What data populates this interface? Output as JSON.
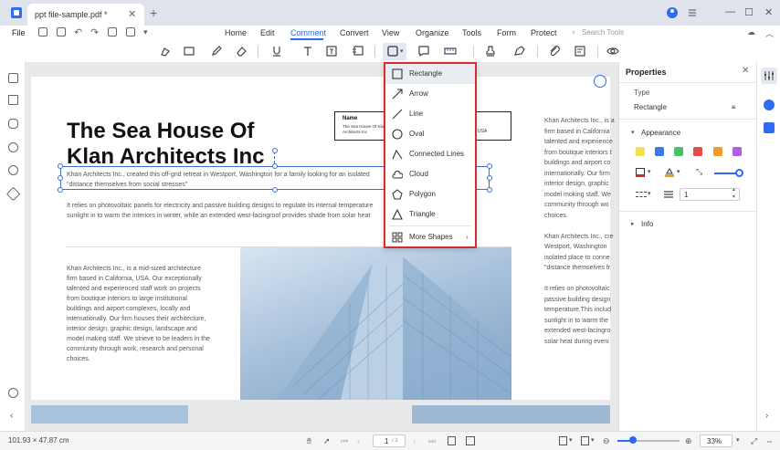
{
  "window": {
    "tab_title": "ppt file-sample.pdf *",
    "tab_close": "✕",
    "new_tab": "+",
    "minimize": "—",
    "maximize": "☐",
    "close": "✕"
  },
  "menubar": {
    "file": "File",
    "tabs": [
      {
        "label": "Home",
        "active": false
      },
      {
        "label": "Edit",
        "active": false
      },
      {
        "label": "Comment",
        "active": true
      },
      {
        "label": "Convert",
        "active": false
      },
      {
        "label": "View",
        "active": false
      },
      {
        "label": "Organize",
        "active": false
      },
      {
        "label": "Tools",
        "active": false
      },
      {
        "label": "Form",
        "active": false
      },
      {
        "label": "Protect",
        "active": false
      }
    ],
    "search_placeholder": "Search Tools"
  },
  "document": {
    "title_line1": "The Sea House Of",
    "title_line2": "Klan Architects Inc",
    "namebox": {
      "heading": "Name",
      "line1": "The Sea House Of Klan",
      "line2": "Architects Inc",
      "right": "USA"
    },
    "intro_line1": "Khan Architects Inc., created this off-grid retreat in Westport, Washington for a family looking for an isolated",
    "intro_line2": "\"distance themselves from social stresses\"",
    "para2_line1": "It relies on photovoltaic panels for electricity and passive building designs to regulate its internal temperature",
    "para2_line2": "sunlight in to warm the interiors in winter, while an extended west-facingroof provides shade from solar heat",
    "col1": [
      "Khan Architects Inc., is a mid-sized architecture",
      "firm based in California, USA. Our exceptionally",
      "talented and experienced staff work on projects",
      "from boutique interiors to large institutional",
      "buildings and airport complexes, locally and",
      "internationally. Our firm houses their architecture,",
      "interior design, graphic design, landscape and",
      "model making staff. We strieve to be leaders in the",
      "community through work, research and personal",
      "choices."
    ],
    "right_col": [
      "Khan Architects Inc., is a",
      "firm based in California",
      "talented and experience",
      "from boutique interiors t",
      "buildings and airport co",
      "internationally. Our firm",
      "interior design, graphic",
      "model moking staff. We",
      "community through wo",
      "choices.",
      "",
      "Khan Architects Inc., cre",
      "Westport, Washington",
      "isolated place to conne",
      "\"distance themselves fr",
      "",
      "It relies on photovoltaic",
      "passive building design",
      "temperature.This includ",
      "sunlight in to warm the",
      "extended west-facingro",
      "solar heat during eveni"
    ]
  },
  "shapes_menu": {
    "items": [
      {
        "label": "Rectangle",
        "icon": "rectangle-icon",
        "selected": true
      },
      {
        "label": "Arrow",
        "icon": "arrow-icon",
        "selected": false
      },
      {
        "label": "Line",
        "icon": "line-icon",
        "selected": false
      },
      {
        "label": "Oval",
        "icon": "oval-icon",
        "selected": false
      },
      {
        "label": "Connected Lines",
        "icon": "connected-lines-icon",
        "selected": false
      },
      {
        "label": "Cloud",
        "icon": "cloud-icon",
        "selected": false
      },
      {
        "label": "Polygon",
        "icon": "polygon-icon",
        "selected": false
      },
      {
        "label": "Triangle",
        "icon": "triangle-icon",
        "selected": false
      }
    ],
    "more": "More Shapes",
    "more_arrow": "›"
  },
  "properties": {
    "title": "Properties",
    "close": "✕",
    "type_label": "Type",
    "type_value": "Rectangle",
    "appearance": "Appearance",
    "swatches": [
      "#f2e14c",
      "#3b78e7",
      "#44c267",
      "#e94b4b",
      "#f39a2b",
      "#b25be3"
    ],
    "thickness_value": "1",
    "info": "Info"
  },
  "status": {
    "dimensions": "101.93 × 47.87 cm",
    "page_current": "1",
    "page_total": "/ 1",
    "zoom": "33%",
    "zoom_level": 0.33
  },
  "colors": {
    "accent": "#2f6bf0",
    "menu_highlight": "#d72c2c"
  }
}
